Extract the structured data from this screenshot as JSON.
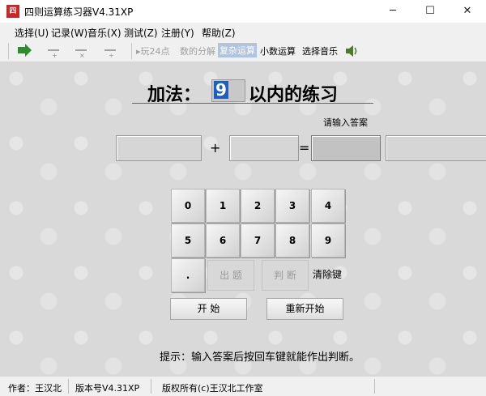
{
  "window": {
    "title": "四则运算练习器V4.31XP",
    "icon_text": "四",
    "controls": {
      "minimize": "─",
      "maximize": "☐",
      "close": "✕"
    }
  },
  "menu": [
    "选择(U)",
    "记录(W)",
    "音乐(X)",
    "测试(Z)",
    "注册(Y)",
    "帮助(Z)"
  ],
  "toolbar": {
    "icons": [
      "go-arrow-icon",
      "add-icon",
      "subtract-icon",
      "multiply-icon",
      "divide-icon"
    ],
    "items": [
      {
        "label": "▸玩24点",
        "state": "disabled"
      },
      {
        "label": "数的分解",
        "state": "disabled"
      },
      {
        "label": "复杂运算",
        "state": "active"
      },
      {
        "label": "小数运算",
        "state": "normal"
      },
      {
        "label": "选择音乐",
        "state": "normal"
      }
    ],
    "speaker_icon": "speaker-icon"
  },
  "heading": {
    "label": "加法：",
    "number": "9",
    "suffix": "以内的练习"
  },
  "answer_hint": "请输入答案",
  "equation": {
    "plus": "+",
    "equals": "="
  },
  "keypad": {
    "row1": [
      "0",
      "1",
      "2",
      "3",
      "4"
    ],
    "row2": [
      "5",
      "6",
      "7",
      "8",
      "9"
    ],
    "dot": ".",
    "question": "出 题",
    "judge": "判 断",
    "clear": "清除键"
  },
  "buttons": {
    "start": "开 始",
    "restart": "重新开始"
  },
  "tip": "提示：输入答案后按回车键就能作出判断。",
  "status": {
    "author": "作者：王汉北",
    "version": "版本号V4.31XP",
    "copyright": "版权所有(c)王汉北工作室"
  },
  "colors": {
    "selection": "#1c5ec2",
    "active_tab": "#b0c4de",
    "background": "#d9d9d9"
  }
}
